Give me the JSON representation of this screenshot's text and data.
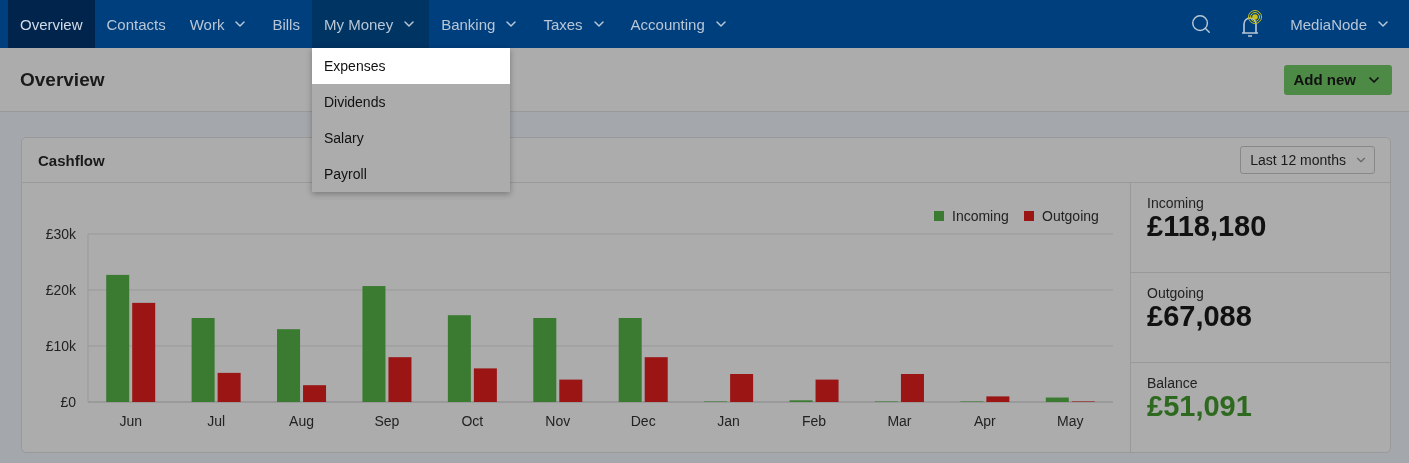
{
  "nav": {
    "items": [
      {
        "label": "Overview",
        "selected": true,
        "has_menu": false,
        "expanded": false
      },
      {
        "label": "Contacts",
        "selected": false,
        "has_menu": false,
        "expanded": false
      },
      {
        "label": "Work",
        "selected": false,
        "has_menu": true,
        "expanded": false
      },
      {
        "label": "Bills",
        "selected": false,
        "has_menu": false,
        "expanded": false
      },
      {
        "label": "My Money",
        "selected": false,
        "has_menu": true,
        "expanded": true,
        "menu": [
          {
            "label": "Expenses",
            "selected": true
          },
          {
            "label": "Dividends",
            "selected": false
          },
          {
            "label": "Salary",
            "selected": false
          },
          {
            "label": "Payroll",
            "selected": false
          }
        ]
      },
      {
        "label": "Banking",
        "selected": false,
        "has_menu": true,
        "expanded": false
      },
      {
        "label": "Taxes",
        "selected": false,
        "has_menu": true,
        "expanded": false
      },
      {
        "label": "Accounting",
        "selected": false,
        "has_menu": true,
        "expanded": false
      }
    ],
    "notifications_unread": true,
    "account": "MediaNode"
  },
  "header": {
    "title": "Overview",
    "add_button": "Add new"
  },
  "cashflow": {
    "title": "Cashflow",
    "range": "Last 12 months",
    "chart_data": {
      "type": "bar",
      "categories": [
        "Jun",
        "Jul",
        "Aug",
        "Sep",
        "Oct",
        "Nov",
        "Dec",
        "Jan",
        "Feb",
        "Mar",
        "Apr",
        "May"
      ],
      "series": [
        {
          "name": "Incoming",
          "color": "#3a7a31",
          "values": [
            22700,
            15000,
            13000,
            20700,
            15500,
            15000,
            15000,
            100,
            300,
            100,
            100,
            800
          ]
        },
        {
          "name": "Outgoing",
          "color": "#9b1515",
          "values": [
            17700,
            5200,
            3000,
            8000,
            6000,
            4000,
            8000,
            5000,
            4000,
            5000,
            1000,
            100
          ]
        }
      ],
      "ylim": [
        0,
        30000
      ],
      "legend": true,
      "yticks": [
        {
          "value": 0,
          "label": "£0"
        },
        {
          "value": 10000,
          "label": "£10k"
        },
        {
          "value": 20000,
          "label": "£20k"
        },
        {
          "value": 30000,
          "label": "£30k"
        }
      ]
    },
    "stats": [
      {
        "label": "Incoming",
        "value": "£118,180",
        "positive": false
      },
      {
        "label": "Outgoing",
        "value": "£67,088",
        "positive": false
      },
      {
        "label": "Balance",
        "value": "£51,091",
        "positive": true
      }
    ]
  }
}
